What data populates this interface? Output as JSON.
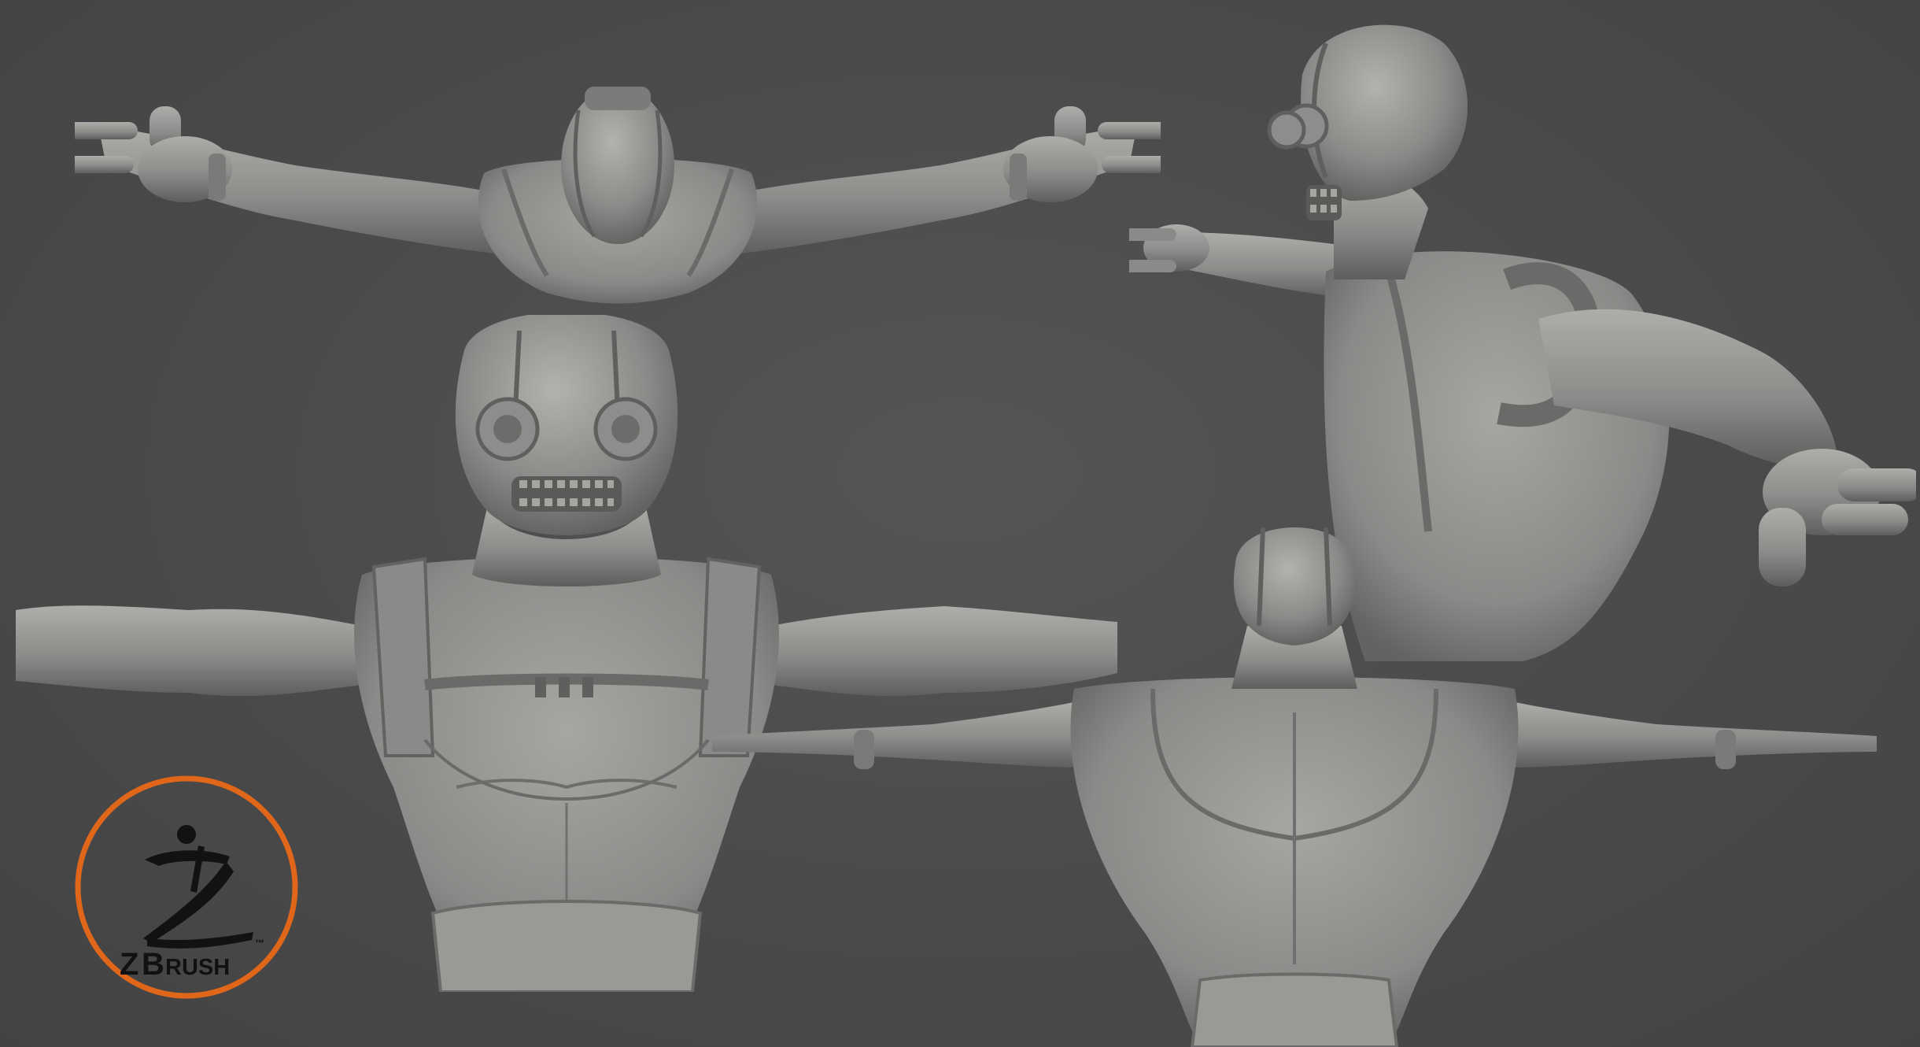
{
  "scene": {
    "description_colors": {
      "background": "#4a4a4b",
      "clay": "#8e8e8c",
      "clay_shadow": "#5f5f5e",
      "clay_highlight": "#b3b3b0",
      "logo_ring": "#e0661a"
    },
    "views": [
      {
        "name": "top-view"
      },
      {
        "name": "front-view"
      },
      {
        "name": "three-quarter-view"
      },
      {
        "name": "back-view"
      }
    ]
  },
  "logo": {
    "word_z": "Z",
    "word_b": "B",
    "word_rest": "RUSH",
    "tm": "™",
    "icon": "zbrush-figure-icon"
  }
}
